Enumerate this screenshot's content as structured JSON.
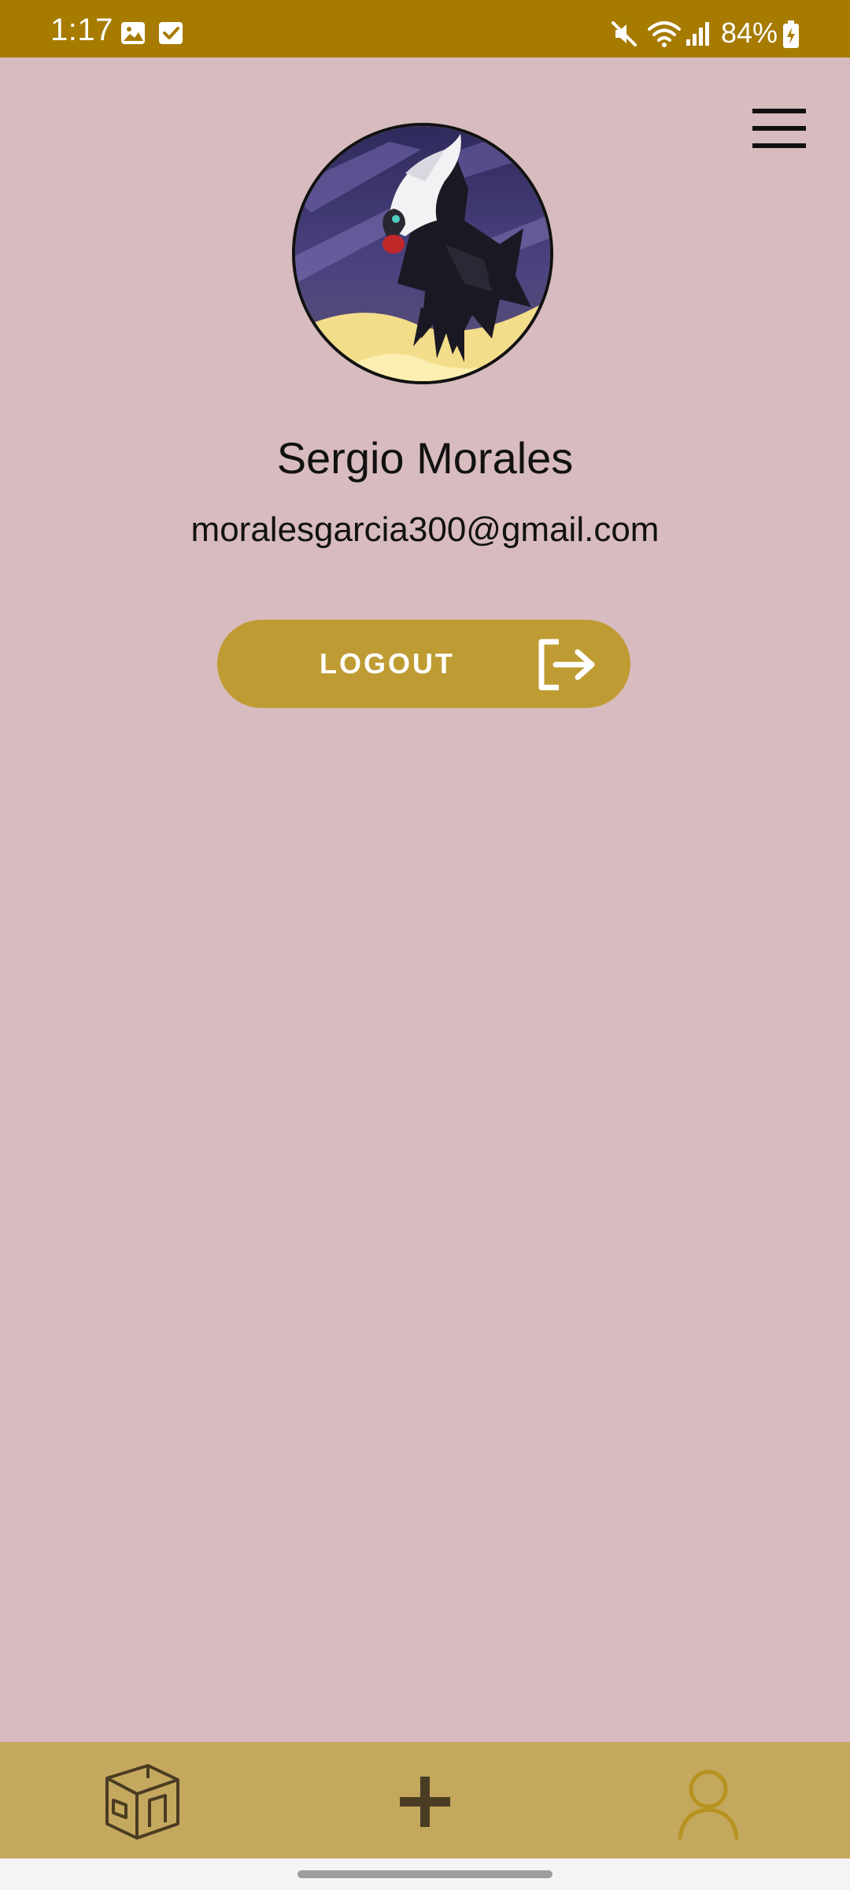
{
  "status_bar": {
    "time": "1:17",
    "battery": "84%",
    "icons": [
      "gallery-icon",
      "check-box-icon",
      "mute-icon",
      "wifi-icon",
      "signal-icon",
      "battery-charging-icon"
    ]
  },
  "header": {
    "menu_icon": "hamburger-menu-icon"
  },
  "profile": {
    "name": "Sergio Morales",
    "email": "moralesgarcia300@gmail.com",
    "avatar_icon": "profile-avatar"
  },
  "logout": {
    "label": "LOGOUT",
    "icon": "logout-icon"
  },
  "bottom_nav": {
    "items": [
      {
        "name": "rooms",
        "icon": "room-cube-icon",
        "active": false
      },
      {
        "name": "add",
        "icon": "plus-icon",
        "active": false
      },
      {
        "name": "profile",
        "icon": "person-icon",
        "active": true
      }
    ]
  },
  "colors": {
    "status_bar": "#a67b00",
    "background": "#d7bbbe",
    "button": "#bf9b33",
    "bottom_nav": "#c4a85e",
    "active_nav_icon": "#b8921f",
    "inactive_nav_icon": "#4a3c22"
  }
}
